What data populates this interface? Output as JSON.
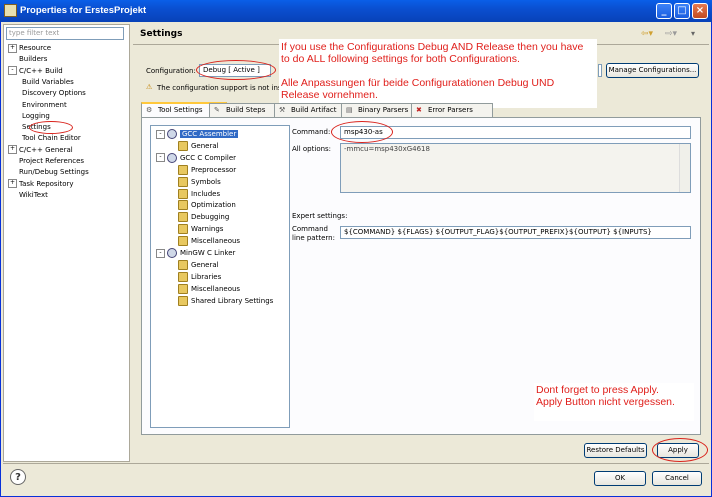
{
  "window": {
    "title": "Properties for ErstesProjekt"
  },
  "left": {
    "filter_placeholder": "type filter text",
    "tree": [
      {
        "label": "Resource",
        "indent": 0,
        "exp": "+"
      },
      {
        "label": "Builders",
        "indent": 0,
        "exp": ""
      },
      {
        "label": "C/C++ Build",
        "indent": 0,
        "exp": "-"
      },
      {
        "label": "Build Variables",
        "indent": 1,
        "exp": ""
      },
      {
        "label": "Discovery Options",
        "indent": 1,
        "exp": ""
      },
      {
        "label": "Environment",
        "indent": 1,
        "exp": ""
      },
      {
        "label": "Logging",
        "indent": 1,
        "exp": ""
      },
      {
        "label": "Settings",
        "indent": 1,
        "exp": ""
      },
      {
        "label": "Tool Chain Editor",
        "indent": 1,
        "exp": ""
      },
      {
        "label": "C/C++ General",
        "indent": 0,
        "exp": "+"
      },
      {
        "label": "Project References",
        "indent": 0,
        "exp": ""
      },
      {
        "label": "Run/Debug Settings",
        "indent": 0,
        "exp": ""
      },
      {
        "label": "Task Repository",
        "indent": 0,
        "exp": "+"
      },
      {
        "label": "WikiText",
        "indent": 0,
        "exp": ""
      }
    ]
  },
  "header": {
    "title": "Settings"
  },
  "config": {
    "label": "Configuration:",
    "value": "Debug  [ Active ]",
    "manage_label": "Manage Configurations...",
    "warning": "The configuration support is not insta"
  },
  "notes": {
    "top_en": "If you use the Configurations Debug AND Release then you have to do ALL following settings for both Configurations.",
    "top_de": "Alle Anpassungen für beide Configuratationen Debug UND Release vornehmen.",
    "bottom_en": "Dont forget to press Apply.",
    "bottom_de": "Apply Button nicht vergessen."
  },
  "tabs": [
    "Tool Settings",
    "Build Steps",
    "Build Artifact",
    "Binary Parsers",
    "Error Parsers"
  ],
  "tooltree": [
    {
      "label": "GCC Assembler",
      "indent": 0,
      "kind": "group",
      "selected": true
    },
    {
      "label": "General",
      "indent": 1,
      "kind": "opt"
    },
    {
      "label": "GCC C Compiler",
      "indent": 0,
      "kind": "group"
    },
    {
      "label": "Preprocessor",
      "indent": 1,
      "kind": "opt"
    },
    {
      "label": "Symbols",
      "indent": 1,
      "kind": "opt"
    },
    {
      "label": "Includes",
      "indent": 1,
      "kind": "opt"
    },
    {
      "label": "Optimization",
      "indent": 1,
      "kind": "opt"
    },
    {
      "label": "Debugging",
      "indent": 1,
      "kind": "opt"
    },
    {
      "label": "Warnings",
      "indent": 1,
      "kind": "opt"
    },
    {
      "label": "Miscellaneous",
      "indent": 1,
      "kind": "opt"
    },
    {
      "label": "MinGW C Linker",
      "indent": 0,
      "kind": "group"
    },
    {
      "label": "General",
      "indent": 1,
      "kind": "opt"
    },
    {
      "label": "Libraries",
      "indent": 1,
      "kind": "opt"
    },
    {
      "label": "Miscellaneous",
      "indent": 1,
      "kind": "opt"
    },
    {
      "label": "Shared Library Settings",
      "indent": 1,
      "kind": "opt"
    }
  ],
  "settings": {
    "command_label": "Command:",
    "command_value": "msp430-as",
    "all_options_label": "All options:",
    "all_options_value": "-mmcu=msp430xG4618",
    "expert_label": "Expert settings:",
    "pattern_label_1": "Command",
    "pattern_label_2": "line pattern:",
    "pattern_value": "${COMMAND} ${FLAGS} ${OUTPUT_FLAG}${OUTPUT_PREFIX}${OUTPUT} ${INPUTS}"
  },
  "buttons": {
    "restore": "Restore Defaults",
    "apply": "Apply",
    "ok": "OK",
    "cancel": "Cancel"
  }
}
